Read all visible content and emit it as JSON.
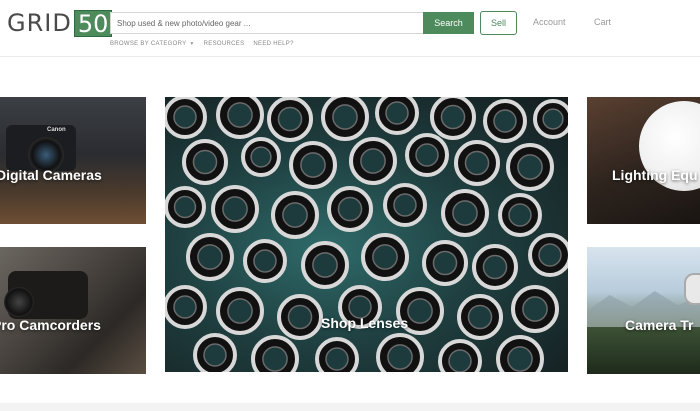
{
  "header": {
    "logo_text": "GRID",
    "logo_number": "50",
    "search_placeholder": "Shop used & new photo/video gear ...",
    "search_button": "Search",
    "sell_button": "Sell",
    "account_link": "Account",
    "cart_link": "Cart"
  },
  "subnav": {
    "browse": "BROWSE BY CATEGORY",
    "resources": "RESOURCES",
    "help": "NEED HELP?"
  },
  "categories": [
    {
      "label": "Digital Cameras"
    },
    {
      "label": "Pro Camcorders"
    },
    {
      "label": "Shop Lenses"
    },
    {
      "label": "Lighting Equ"
    },
    {
      "label": "Camera Tr"
    }
  ],
  "colors": {
    "brand_green": "#4d8a5c"
  }
}
